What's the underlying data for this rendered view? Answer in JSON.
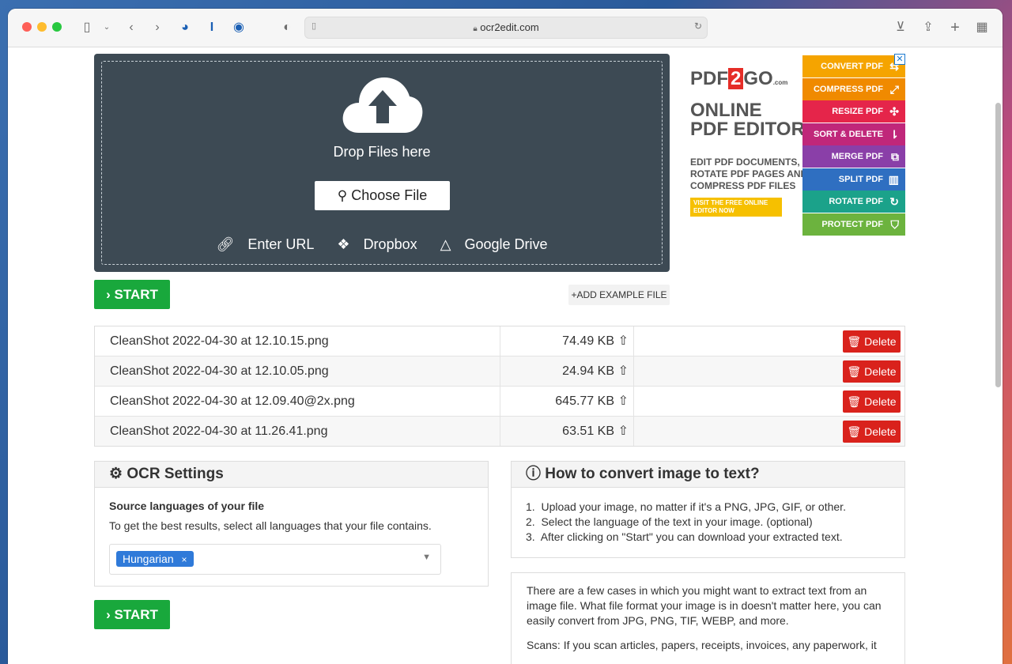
{
  "browser": {
    "url": "ocr2edit.com"
  },
  "upload": {
    "drop_text": "Drop Files here",
    "choose_label": "Choose File",
    "enter_url": "Enter URL",
    "dropbox": "Dropbox",
    "google_drive": "Google Drive"
  },
  "ad": {
    "logo_pre": "PDF",
    "logo_num": "2",
    "logo_post": "GO",
    "logo_suffix": ".com",
    "title_line1": "ONLINE",
    "title_line2": "PDF EDITOR",
    "sub_line1": "EDIT PDF DOCUMENTS,",
    "sub_line2": "ROTATE PDF PAGES AND",
    "sub_line3": "COMPRESS PDF FILES",
    "cta": "VISIT THE FREE ONLINE EDITOR NOW",
    "items": [
      {
        "label": "CONVERT PDF",
        "color": "#f5a400"
      },
      {
        "label": "COMPRESS PDF",
        "color": "#f08a00"
      },
      {
        "label": "RESIZE PDF",
        "color": "#e5254a"
      },
      {
        "label": "SORT & DELETE",
        "color": "#c0277a"
      },
      {
        "label": "MERGE PDF",
        "color": "#8a3fa8"
      },
      {
        "label": "SPLIT PDF",
        "color": "#2f6fc1"
      },
      {
        "label": "ROTATE PDF",
        "color": "#1ba28a"
      },
      {
        "label": "PROTECT PDF",
        "color": "#6cb33e"
      }
    ]
  },
  "actions": {
    "start_label": "START",
    "add_example_label": "ADD EXAMPLE FILE"
  },
  "files": [
    {
      "name": "CleanShot 2022-04-30 at 12.10.15.png",
      "size": "74.49 KB",
      "delete": "Delete"
    },
    {
      "name": "CleanShot 2022-04-30 at 12.10.05.png",
      "size": "24.94 KB",
      "delete": "Delete"
    },
    {
      "name": "CleanShot 2022-04-30 at 12.09.40@2x.png",
      "size": "645.77 KB",
      "delete": "Delete"
    },
    {
      "name": "CleanShot 2022-04-30 at 11.26.41.png",
      "size": "63.51 KB",
      "delete": "Delete"
    }
  ],
  "ocr_settings": {
    "title": "OCR Settings",
    "source_label": "Source languages of your file",
    "hint": "To get the best results, select all languages that your file contains.",
    "selected_language": "Hungarian"
  },
  "howto": {
    "title": "How to convert image to text?",
    "steps": [
      "Upload your image, no matter if it's a PNG, JPG, GIF, or other.",
      "Select the language of the text in your image. (optional)",
      "After clicking on \"Start\" you can download your extracted text."
    ],
    "para1": "There are a few cases in which you might want to extract text from an image file. What file format your image is in doesn't matter here, you can easily convert from JPG, PNG, TIF, WEBP, and more.",
    "para2": "Scans: If you scan articles, papers, receipts, invoices, any paperwork, it"
  }
}
